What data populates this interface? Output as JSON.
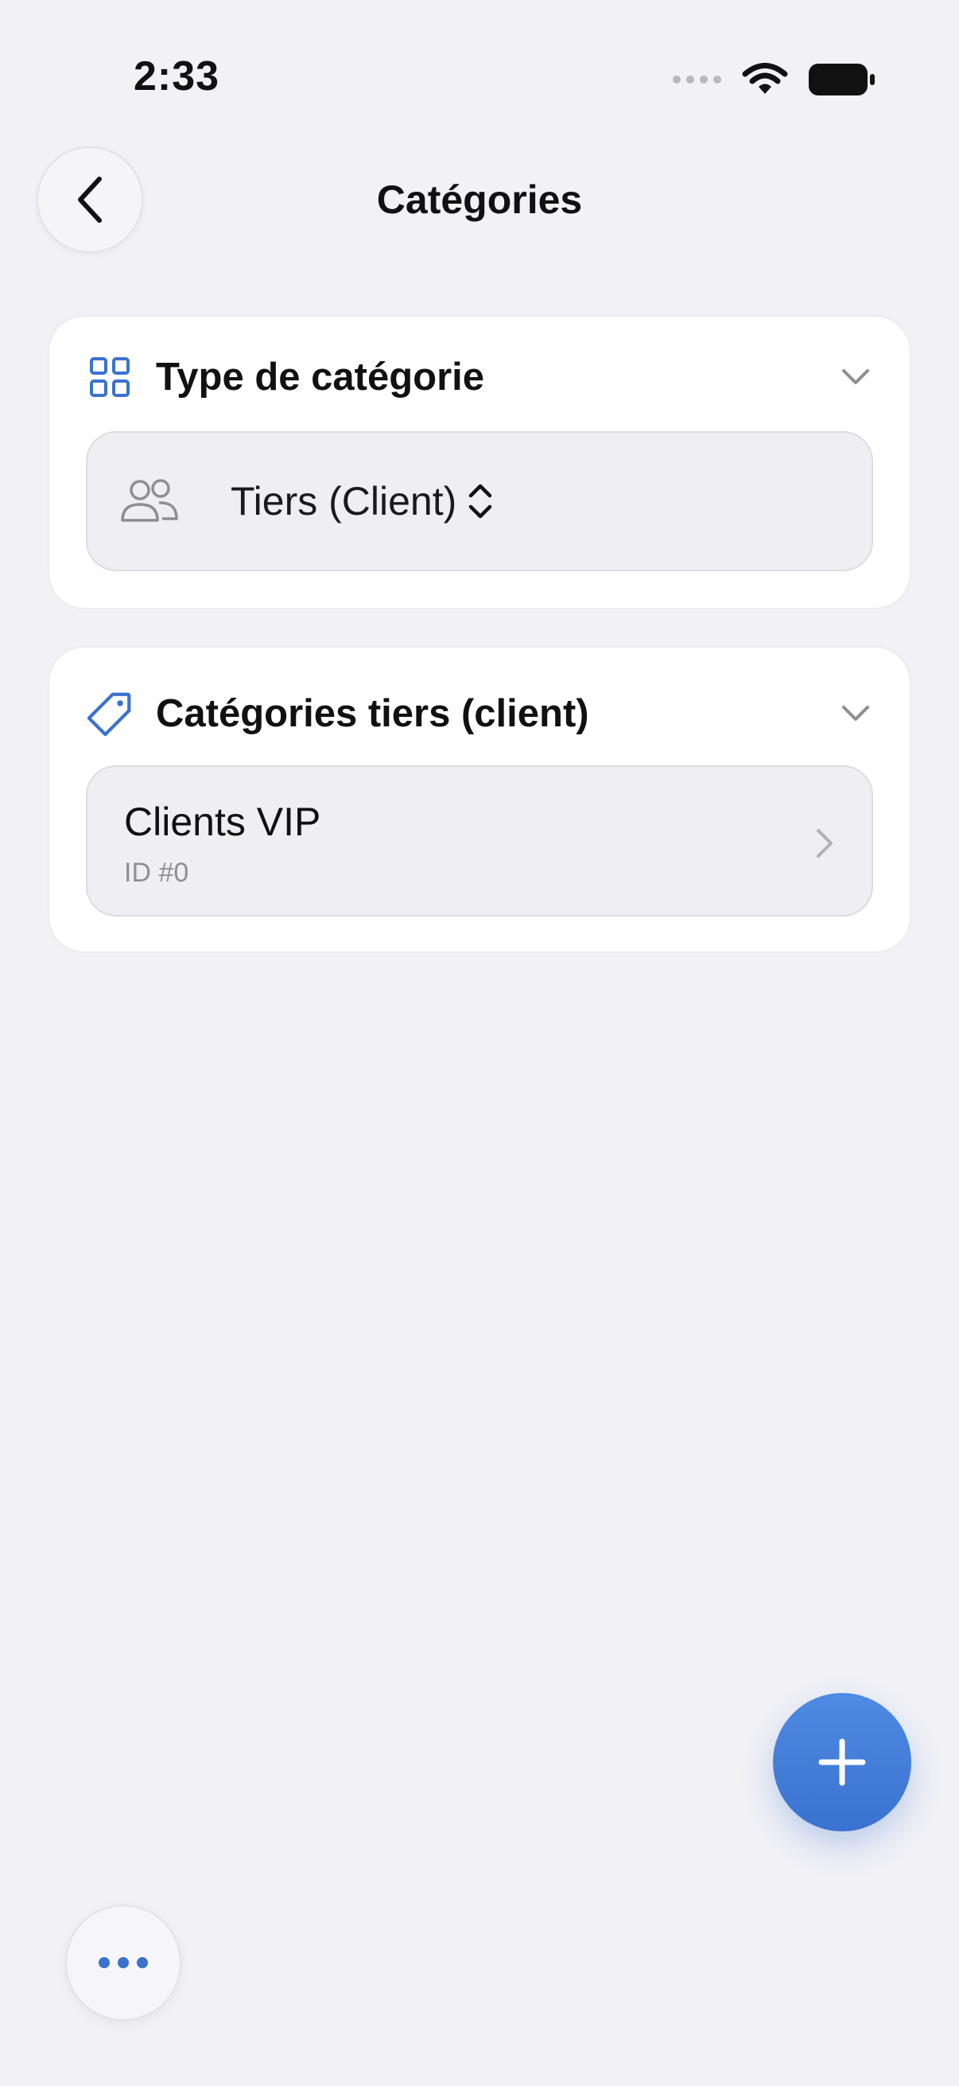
{
  "status_bar": {
    "time": "2:33",
    "icons": [
      "signal-dots-icon",
      "wifi-icon",
      "battery-icon"
    ]
  },
  "nav": {
    "back_icon": "chevron-left-icon",
    "title": "Catégories"
  },
  "category_type_card": {
    "icon": "grid-icon",
    "title": "Type de catégorie",
    "collapse_icon": "chevron-down-icon",
    "select": {
      "icon": "people-icon",
      "value": "Tiers (Client)",
      "indicator_icon": "chevron-up-down-icon"
    }
  },
  "categories_card": {
    "icon": "tag-icon",
    "title": "Catégories tiers (client)",
    "collapse_icon": "chevron-down-icon",
    "items": [
      {
        "name": "Clients VIP",
        "subtitle": "ID #0"
      }
    ]
  },
  "fab": {
    "icon": "plus-icon"
  },
  "more_button": {
    "icon": "ellipsis-icon"
  },
  "colors": {
    "accent": "#3a72d0",
    "background": "#f1f1f6",
    "card": "#ffffff",
    "field": "#efeff3",
    "secondary_text": "#8e8e93"
  }
}
